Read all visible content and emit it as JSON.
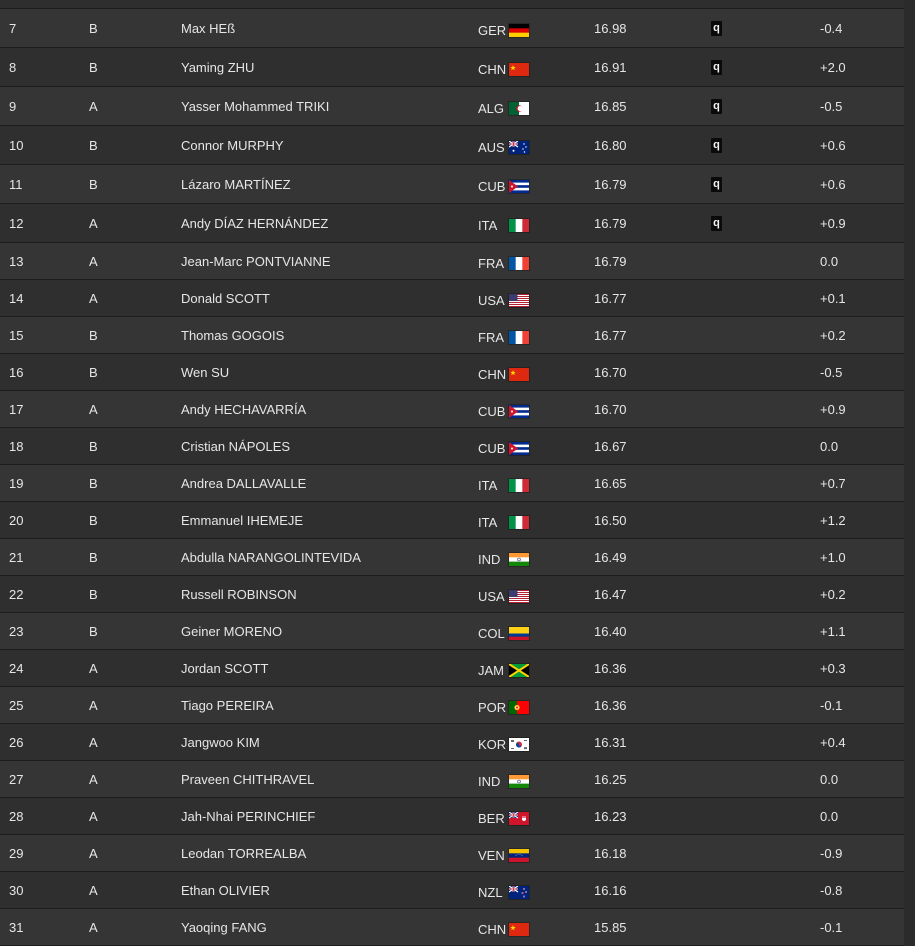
{
  "results": {
    "rows": [
      {
        "rank": "7",
        "group": "B",
        "name": "Max HEß",
        "nat": "GER",
        "flag": "ger-flag-icon",
        "mark": "16.98",
        "q": "q",
        "wind": "-0.4"
      },
      {
        "rank": "8",
        "group": "B",
        "name": "Yaming ZHU",
        "nat": "CHN",
        "flag": "chn-flag-icon",
        "mark": "16.91",
        "q": "q",
        "wind": "+2.0"
      },
      {
        "rank": "9",
        "group": "A",
        "name": "Yasser Mohammed TRIKI",
        "nat": "ALG",
        "flag": "alg-flag-icon",
        "mark": "16.85",
        "q": "q",
        "wind": "-0.5"
      },
      {
        "rank": "10",
        "group": "B",
        "name": "Connor MURPHY",
        "nat": "AUS",
        "flag": "aus-flag-icon",
        "mark": "16.80",
        "q": "q",
        "wind": "+0.6"
      },
      {
        "rank": "11",
        "group": "B",
        "name": "Lázaro MARTÍNEZ",
        "nat": "CUB",
        "flag": "cub-flag-icon",
        "mark": "16.79",
        "q": "q",
        "wind": "+0.6"
      },
      {
        "rank": "12",
        "group": "A",
        "name": "Andy DÍAZ HERNÁNDEZ",
        "nat": "ITA",
        "flag": "ita-flag-icon",
        "mark": "16.79",
        "q": "q",
        "wind": "+0.9"
      },
      {
        "rank": "13",
        "group": "A",
        "name": "Jean-Marc PONTVIANNE",
        "nat": "FRA",
        "flag": "fra-flag-icon",
        "mark": "16.79",
        "q": "",
        "wind": "0.0"
      },
      {
        "rank": "14",
        "group": "A",
        "name": "Donald SCOTT",
        "nat": "USA",
        "flag": "usa-flag-icon",
        "mark": "16.77",
        "q": "",
        "wind": "+0.1"
      },
      {
        "rank": "15",
        "group": "B",
        "name": "Thomas GOGOIS",
        "nat": "FRA",
        "flag": "fra-flag-icon",
        "mark": "16.77",
        "q": "",
        "wind": "+0.2"
      },
      {
        "rank": "16",
        "group": "B",
        "name": "Wen SU",
        "nat": "CHN",
        "flag": "chn-flag-icon",
        "mark": "16.70",
        "q": "",
        "wind": "-0.5"
      },
      {
        "rank": "17",
        "group": "A",
        "name": "Andy HECHAVARRÍA",
        "nat": "CUB",
        "flag": "cub-flag-icon",
        "mark": "16.70",
        "q": "",
        "wind": "+0.9"
      },
      {
        "rank": "18",
        "group": "B",
        "name": "Cristian NÁPOLES",
        "nat": "CUB",
        "flag": "cub-flag-icon",
        "mark": "16.67",
        "q": "",
        "wind": "0.0"
      },
      {
        "rank": "19",
        "group": "B",
        "name": "Andrea DALLAVALLE",
        "nat": "ITA",
        "flag": "ita-flag-icon",
        "mark": "16.65",
        "q": "",
        "wind": "+0.7"
      },
      {
        "rank": "20",
        "group": "B",
        "name": "Emmanuel IHEMEJE",
        "nat": "ITA",
        "flag": "ita-flag-icon",
        "mark": "16.50",
        "q": "",
        "wind": "+1.2"
      },
      {
        "rank": "21",
        "group": "B",
        "name": "Abdulla NARANGOLINTEVIDA",
        "nat": "IND",
        "flag": "ind-flag-icon",
        "mark": "16.49",
        "q": "",
        "wind": "+1.0"
      },
      {
        "rank": "22",
        "group": "B",
        "name": "Russell ROBINSON",
        "nat": "USA",
        "flag": "usa-flag-icon",
        "mark": "16.47",
        "q": "",
        "wind": "+0.2"
      },
      {
        "rank": "23",
        "group": "B",
        "name": "Geiner MORENO",
        "nat": "COL",
        "flag": "col-flag-icon",
        "mark": "16.40",
        "q": "",
        "wind": "+1.1"
      },
      {
        "rank": "24",
        "group": "A",
        "name": "Jordan SCOTT",
        "nat": "JAM",
        "flag": "jam-flag-icon",
        "mark": "16.36",
        "q": "",
        "wind": "+0.3"
      },
      {
        "rank": "25",
        "group": "A",
        "name": "Tiago PEREIRA",
        "nat": "POR",
        "flag": "por-flag-icon",
        "mark": "16.36",
        "q": "",
        "wind": "-0.1"
      },
      {
        "rank": "26",
        "group": "A",
        "name": "Jangwoo KIM",
        "nat": "KOR",
        "flag": "kor-flag-icon",
        "mark": "16.31",
        "q": "",
        "wind": "+0.4"
      },
      {
        "rank": "27",
        "group": "A",
        "name": "Praveen CHITHRAVEL",
        "nat": "IND",
        "flag": "ind-flag-icon",
        "mark": "16.25",
        "q": "",
        "wind": "0.0"
      },
      {
        "rank": "28",
        "group": "A",
        "name": "Jah-Nhai PERINCHIEF",
        "nat": "BER",
        "flag": "ber-flag-icon",
        "mark": "16.23",
        "q": "",
        "wind": "0.0"
      },
      {
        "rank": "29",
        "group": "A",
        "name": "Leodan TORREALBA",
        "nat": "VEN",
        "flag": "ven-flag-icon",
        "mark": "16.18",
        "q": "",
        "wind": "-0.9"
      },
      {
        "rank": "30",
        "group": "A",
        "name": "Ethan OLIVIER",
        "nat": "NZL",
        "flag": "nzl-flag-icon",
        "mark": "16.16",
        "q": "",
        "wind": "-0.8"
      },
      {
        "rank": "31",
        "group": "A",
        "name": "Yaoqing FANG",
        "nat": "CHN",
        "flag": "chn-flag-icon",
        "mark": "15.85",
        "q": "",
        "wind": "-0.1"
      }
    ]
  }
}
